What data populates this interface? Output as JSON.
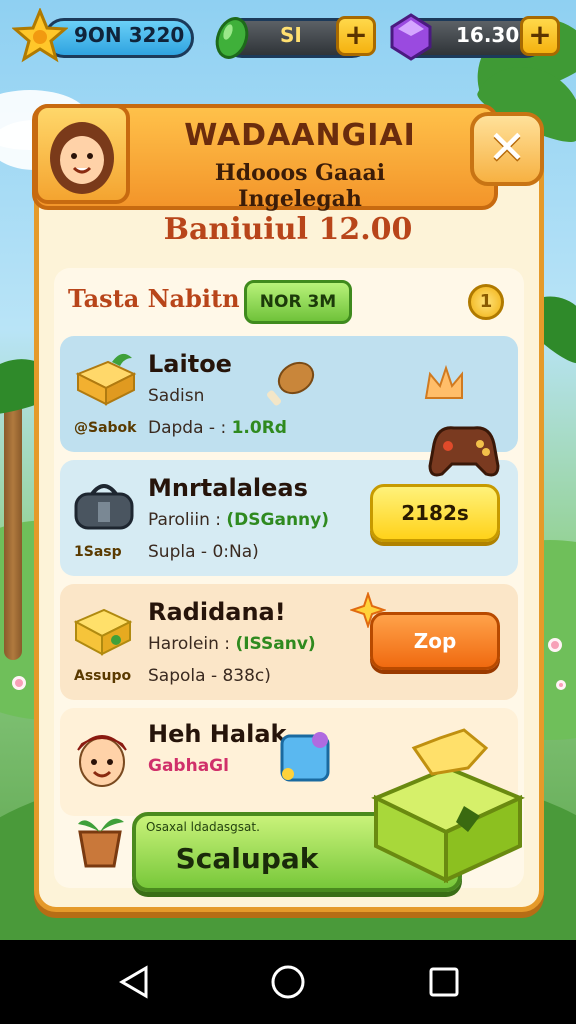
{
  "resources": {
    "star": {
      "value": "9ON 3220",
      "icon": "star-icon"
    },
    "gem_green": {
      "value": "SI",
      "icon": "green-gem-icon"
    },
    "gem_purple": {
      "value": "16.30",
      "icon": "purple-gem-icon"
    },
    "plus_label": "+"
  },
  "header": {
    "title": "WADAANGIAI",
    "subtitle": "Hdooos Gaaai Ingelegah",
    "close_label": "✕"
  },
  "balance_text": "Baniuiul 12.00",
  "section": {
    "title": "Tasta Nabitn",
    "tag_button": "NOR 3M",
    "coin_label": "1"
  },
  "cards": [
    {
      "title": "Laitoe",
      "line1": "Sadisn",
      "line2_prefix": "Dapda - :",
      "line2_value": "1.0Rd",
      "side_tag": "@Sabok",
      "bg": "#bfe0ef"
    },
    {
      "title": "Mnrtalaleas",
      "line1_prefix": "Paroliin : ",
      "line1_value": "(DSGanny)",
      "line2": "Supla - 0:Na)",
      "side_tag": "1Sasp",
      "action": "2182s",
      "bg": "#d6ebf3"
    },
    {
      "title": "Radidana!",
      "line1_prefix": "Harolein : ",
      "line1_value": "(ISSanv)",
      "line2": "Sapola - 838c)",
      "side_tag": "Assupo",
      "action": "Zop",
      "bg": "#fbe6c8"
    },
    {
      "title": "Heh Halak",
      "line1": "GabhaGl",
      "bg": "#fff1d8"
    }
  ],
  "bottom": {
    "hint": "Osaxal ldadasgsat.",
    "label": "Scalupak"
  },
  "colors": {
    "panel_border": "#e59a2a",
    "accent_orange": "#f58a20",
    "accent_green": "#6fc23a",
    "accent_yellow": "#ffd23a"
  }
}
